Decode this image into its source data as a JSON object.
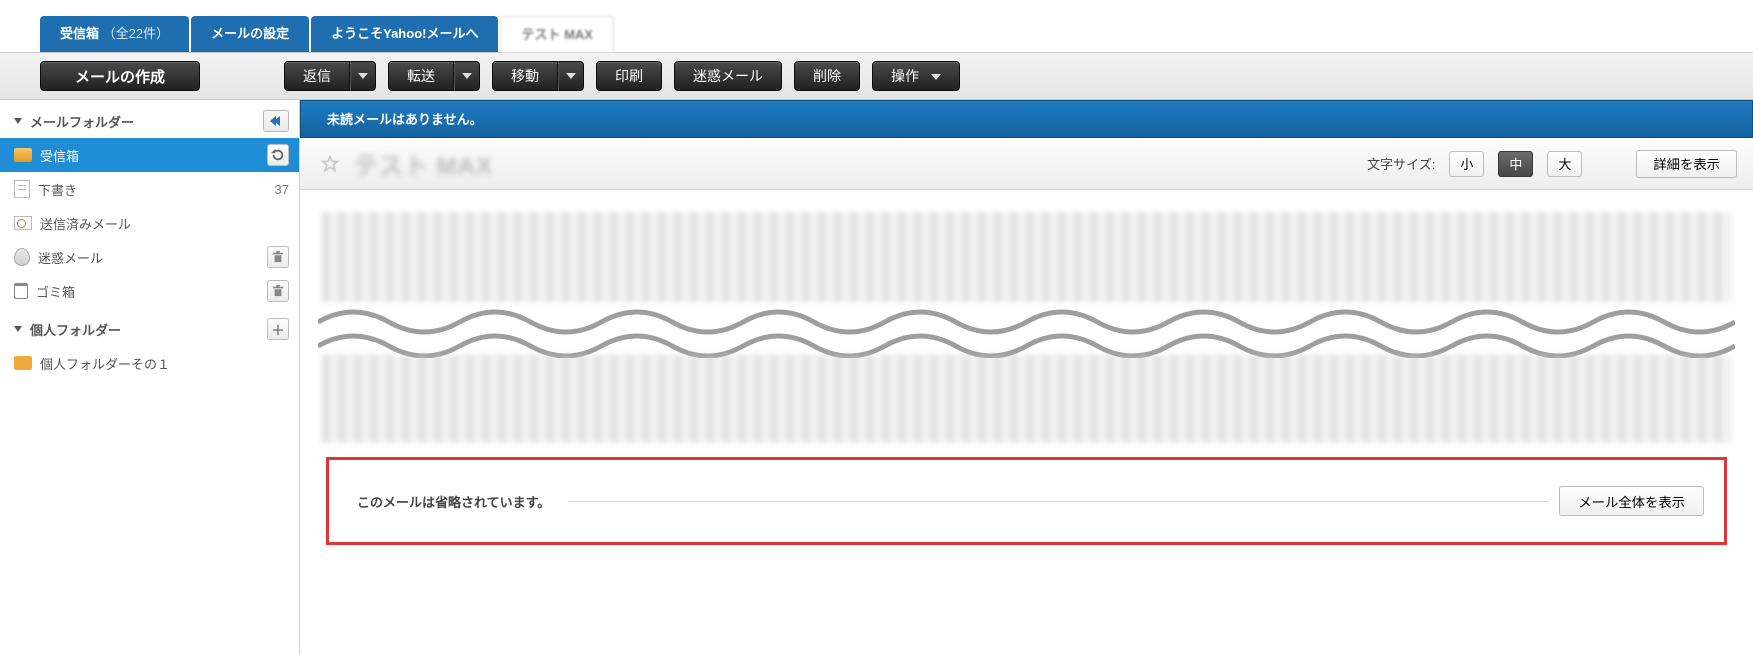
{
  "tabs": {
    "inbox_label": "受信箱",
    "inbox_count": "（全22件）",
    "settings": "メールの設定",
    "welcome": "ようこそYahoo!メールへ",
    "extra_blur": "テスト MAX"
  },
  "toolbar": {
    "compose": "メールの作成",
    "reply": "返信",
    "forward": "転送",
    "move": "移動",
    "print": "印刷",
    "spam": "迷惑メール",
    "delete": "削除",
    "action": "操作"
  },
  "sidebar": {
    "header": "メールフォルダー",
    "inbox": "受信箱",
    "drafts": "下書き",
    "drafts_count": "37",
    "sent": "送信済みメール",
    "spam": "迷惑メール",
    "trash": "ゴミ箱",
    "personal_header": "個人フォルダー",
    "personal1": "個人フォルダーその１"
  },
  "notice": {
    "no_unread": "未読メールはありません。"
  },
  "subject": {
    "blur_text": "テスト MAX",
    "fontsize_label": "文字サイズ:",
    "size_small": "小",
    "size_medium": "中",
    "size_large": "大",
    "detail": "詳細を表示"
  },
  "truncate": {
    "message": "このメールは省略されています。",
    "show_full": "メール全体を表示"
  }
}
